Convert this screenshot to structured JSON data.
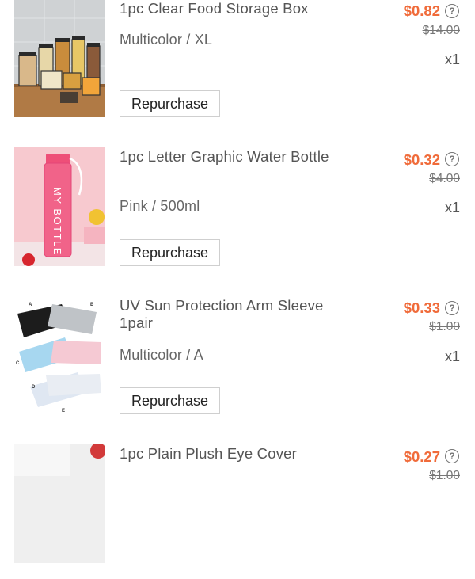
{
  "orders": [
    {
      "title": "1pc Clear Food Storage Box",
      "variant": "Multicolor / XL",
      "price": "$0.82",
      "original_price": "$14.00",
      "quantity": "x1",
      "button": "Repurchase",
      "image_icon": "food-storage-box-image"
    },
    {
      "title": "1pc Letter Graphic Water Bottle",
      "variant": "Pink / 500ml",
      "price": "$0.32",
      "original_price": "$4.00",
      "quantity": "x1",
      "button": "Repurchase",
      "image_icon": "water-bottle-image",
      "image_text": "MY BOTTLE"
    },
    {
      "title": "UV Sun Protection Arm Sleeve 1pair",
      "variant": "Multicolor / A",
      "price": "$0.33",
      "original_price": "$1.00",
      "quantity": "x1",
      "button": "Repurchase",
      "image_icon": "arm-sleeve-image",
      "image_labels": [
        "A",
        "B",
        "C",
        "D",
        "E"
      ]
    },
    {
      "title": "1pc Plain Plush Eye Cover",
      "price": "$0.27",
      "original_price": "$1.00",
      "image_icon": "eye-cover-image"
    }
  ],
  "help_symbol": "?",
  "colors": {
    "price": "#f06b3a",
    "text": "#555555"
  }
}
